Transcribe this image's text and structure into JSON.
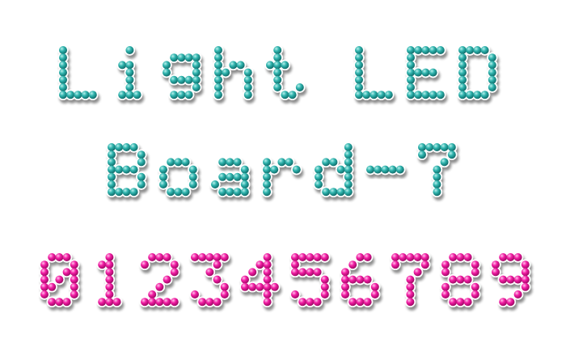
{
  "lines": [
    {
      "text": "Light LED",
      "color": "teal"
    },
    {
      "text": "Board-7",
      "color": "teal"
    },
    {
      "text": "0123456789",
      "color": "pink"
    }
  ],
  "colors": {
    "teal_light": "#b8f0ec",
    "teal_mid": "#2fb3ad",
    "teal_dark": "#0f6c6a",
    "pink_light": "#ffc2ea",
    "pink_mid": "#f21ca3",
    "pink_dark": "#9c0a63",
    "background": "#ffffff",
    "outline": "#ffffff",
    "shadow": "#6e6e6e"
  }
}
